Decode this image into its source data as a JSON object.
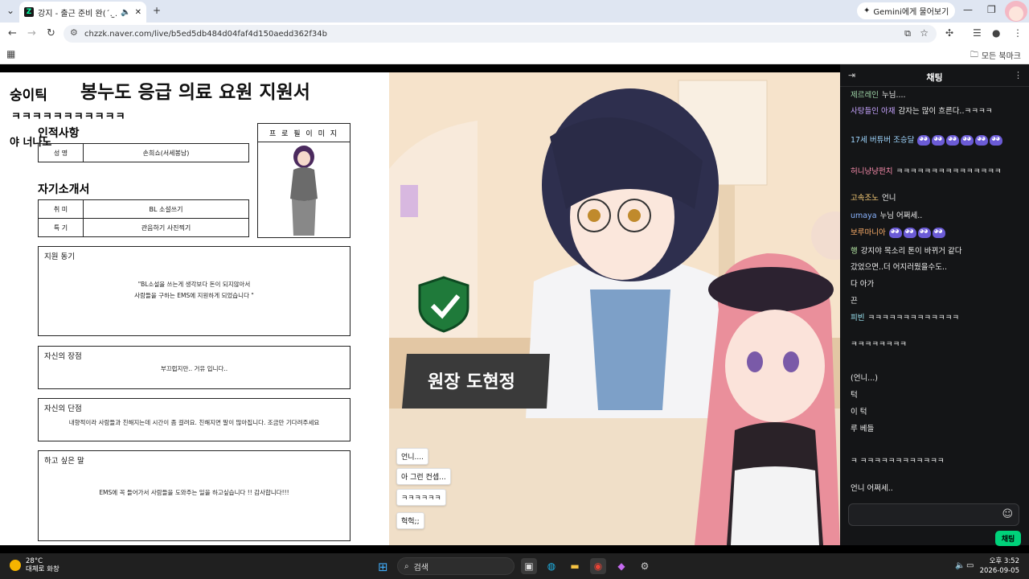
{
  "browser": {
    "tab_title": "강지 - 출근 준비 완(´. ̫.`)",
    "tab_favicon": "Z",
    "gemini_label": "Gemini에게 물어보기",
    "url": "chzzk.naver.com/live/b5ed5db484d04faf4d150aedd362f34b",
    "bookmarks_all": "모든 북마크"
  },
  "doc": {
    "title": "봉누도 응급 의료 요원 지원서",
    "overlay_name": "숭이틱",
    "overlay_laugh": "ㅋㅋㅋㅋㅋㅋㅋㅋㅋㅋㅋ",
    "overlay_ya": "야 너나노",
    "section_personal": "인적사항",
    "name_label": "성 명",
    "name_value": "손희쇼(서세봉남)",
    "profile_header": "프 로 필 이 미 지",
    "section_intro": "자기소개서",
    "hobby_label": "취 미",
    "hobby_value": "BL 소설쓰기",
    "skill_label": "특 기",
    "skill_value": "관음하기 사진찍기",
    "motive_label": "지원 동기",
    "motive_line1": "\"BL소설을 쓰는게 생각보다 돈이 되지않아서",
    "motive_line2": "사람들을 구하는 EMS에 지원하게 되었습니다 \"",
    "strength_label": "자신의 장점",
    "strength_value": "부끄럽지만.. 거유 입니다..",
    "weakness_label": "자신의 단점",
    "weakness_value": "내향적이라 사람들과 친해지는데 시간이 좀 걸려요. 친해지면 말이 많아집니다. 조금만 기다려주세요",
    "wish_label": "하고 싶은 말",
    "wish_value": "EMS에 꼭 들어가서 사람들을 도와주는 일을 하고싶습니다 !! 감사합니다!!!"
  },
  "vn": {
    "nameplate": "원장 도현정",
    "options": [
      "언니....",
      "아 그런 컨셉...",
      "ㅋㅋㅋㅋㅋㅋ",
      "헉헉;;"
    ]
  },
  "chat": {
    "header": "채팅",
    "messages": [
      {
        "name": "제르레인",
        "text": "누님....",
        "color": "#9fd6a8"
      },
      {
        "name": "사탕들인 아재",
        "text": "감자는 많이 흐른다..ㅋㅋㅋㅋ",
        "color": "#c6a3ff"
      },
      {
        "name": "17세 버튜버 조승달",
        "text": "",
        "color": "#9fd6ff"
      },
      {
        "name": "허니냥냥펀치",
        "text": "ㅋㅋㅋㅋㅋㅋㅋㅋㅋㅋㅋㅋㅋㅋㅋ",
        "color": "#ff8fb0"
      },
      {
        "name": "고속조노",
        "text": "언니",
        "color": "#ffd27a"
      },
      {
        "name": "umaya",
        "text": "누님 어쩌세..",
        "color": "#8ab4ff"
      },
      {
        "name": "보루마니아",
        "text": "",
        "color": "#ffb06b"
      },
      {
        "name": "행",
        "text": "강지야 목소리 톤이 바뀌거 같다",
        "color": "#b0e0a0"
      },
      {
        "name": "",
        "text": "갔었으면..더 어지러웠을수도..",
        "color": "#eee"
      },
      {
        "name": "",
        "text": "다 아가",
        "color": "#eee"
      },
      {
        "name": "",
        "text": "끈",
        "color": "#eee"
      },
      {
        "name": "피빈",
        "text": "ㅋㅋㅋㅋㅋㅋㅋㅋㅋㅋㅋㅋㅋ",
        "color": "#a3f0ff"
      },
      {
        "name": "",
        "text": "ㅋㅋㅋㅋㅋㅋㅋㅋ",
        "color": "#eee"
      },
      {
        "name": "",
        "text": "(언니...)",
        "color": "#eee"
      },
      {
        "name": "",
        "text": "턱",
        "color": "#eee"
      },
      {
        "name": "",
        "text": "이 턱",
        "color": "#eee"
      },
      {
        "name": "",
        "text": "루 베들",
        "color": "#eee"
      },
      {
        "name": "",
        "text": "ㅋ ㅋㅋㅋㅋㅋㅋㅋㅋㅋㅋㅋㅋ",
        "color": "#eee"
      },
      {
        "name": "",
        "text": "언니 어쩌세..",
        "color": "#eee"
      }
    ],
    "send_label": "채팅"
  },
  "taskbar": {
    "temp": "28°C",
    "weather": "대체로 화창",
    "search_placeholder": "검색",
    "time": "오후 3:52",
    "date": "2026-09-05"
  }
}
